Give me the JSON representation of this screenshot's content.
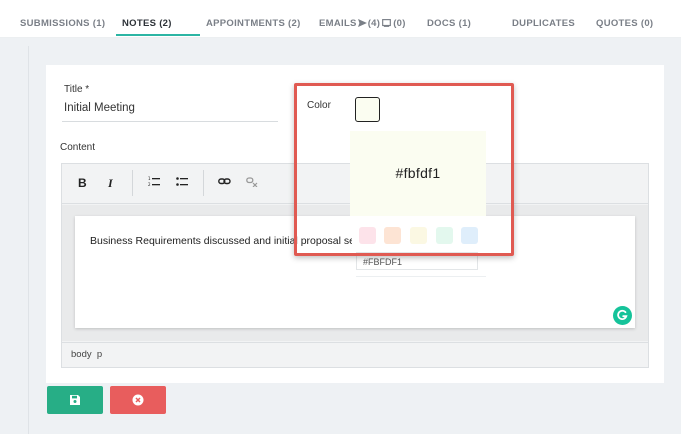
{
  "tabs": [
    {
      "label": "SUBMISSIONS",
      "count": "(1)"
    },
    {
      "label": "NOTES",
      "count": "(2)"
    },
    {
      "label": "APPOINTMENTS",
      "count": "(2)"
    },
    {
      "label": "EMAILS",
      "count": "(4)",
      "count2": "(0)"
    },
    {
      "label": "DOCS",
      "count": "(1)"
    },
    {
      "label": "DUPLICATES",
      "count": ""
    },
    {
      "label": "QUOTES",
      "count": "(0)"
    }
  ],
  "active_tab": "NOTES",
  "form": {
    "title_label": "Title *",
    "title_value": "Initial Meeting",
    "color_label": "Color",
    "content_label": "Content"
  },
  "color_picker": {
    "current_color": "#fbfdf1",
    "preview_text": "#fbfdf1",
    "hex_input_value": "#FBFDF1",
    "presets": [
      "#fde3ea",
      "#fde4d4",
      "#fbf8e3",
      "#e3f8ee",
      "#dfeefb"
    ]
  },
  "editor": {
    "toolbar": {
      "bold": "B",
      "italic": "I"
    },
    "body_text": "Business Requirements discussed and initial proposal se",
    "status_path": "body  p"
  },
  "colors": {
    "accent": "#2cb5a4",
    "save": "#27ae86",
    "cancel": "#e85d5d",
    "highlight": "#e05a52"
  }
}
